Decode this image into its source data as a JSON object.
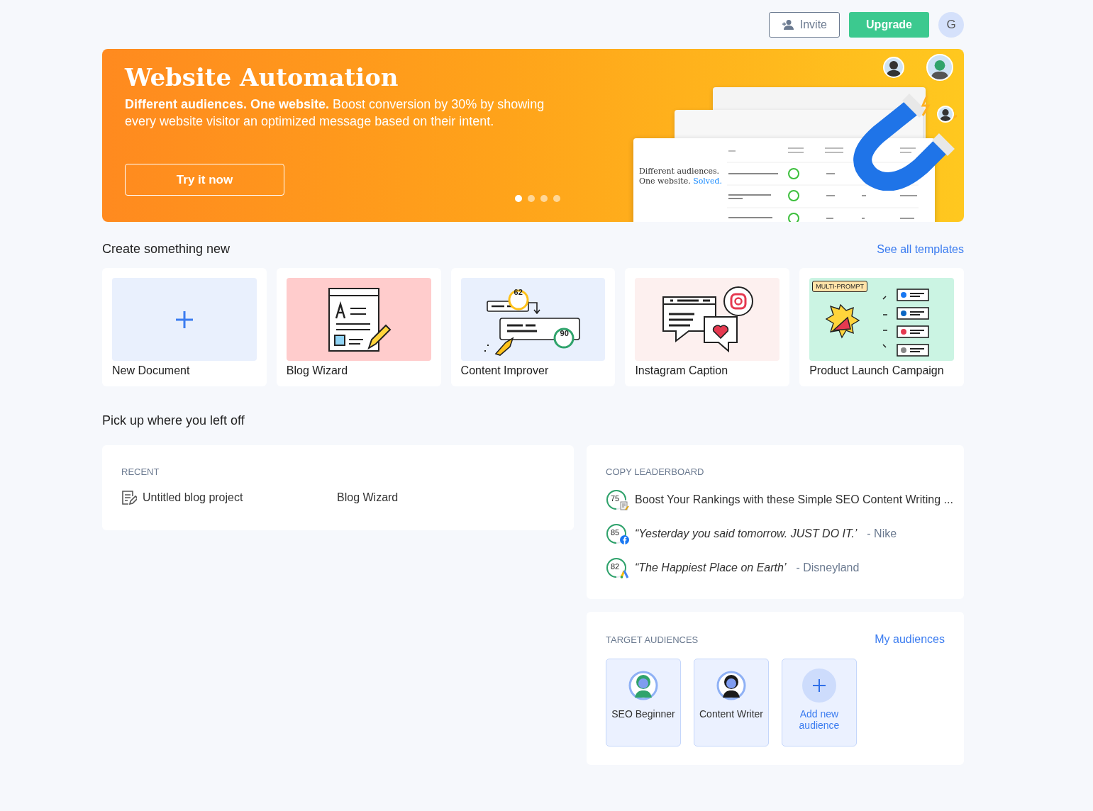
{
  "header": {
    "invite": "Invite",
    "upgrade": "Upgrade",
    "avatar": "G"
  },
  "banner": {
    "title": "Website Automation",
    "subtitle": "**Different audiences. One website.** Boost conversion by 30% by showing every website visitor an optimized message based on their intent.",
    "cta": "Try it now",
    "dots": [
      {
        "selected": true
      },
      {
        "selected": false
      },
      {
        "selected": false
      },
      {
        "selected": false
      }
    ],
    "mockup": {
      "headline": "Different audiences. One website.",
      "highlight": "Solved."
    }
  },
  "create": {
    "title": "Create something new",
    "link": "See all templates",
    "templates": [
      {
        "kind": "blank",
        "label": "New Document"
      },
      {
        "kind": "blog",
        "label": "Blog Wizard"
      },
      {
        "kind": "improver",
        "label": "Content Improver",
        "scores": [
          "62",
          "90"
        ]
      },
      {
        "kind": "instagram",
        "label": "Instagram Caption"
      },
      {
        "kind": "launch",
        "label": "Product Launch Campaign",
        "badge": "MULTI-PROMPT"
      }
    ]
  },
  "resume": {
    "title": "Pick up where you left off"
  },
  "recent": {
    "title": "RECENT",
    "items": [
      {
        "name": "Untitled blog project",
        "template": "Blog Wizard"
      }
    ]
  },
  "leaderboard": {
    "title": "COPY LEADERBOARD",
    "items": [
      {
        "kind": "article",
        "score": "75",
        "text": "Boost Your Rankings with these Simple SEO Content Writing ..."
      },
      {
        "kind": "quote",
        "score": "85",
        "text": "“Yesterday you said tomorrow. JUST DO IT.’",
        "author": "- Nike"
      },
      {
        "kind": "quote",
        "score": "82",
        "text": "“The Happiest Place on Earth’",
        "author": "- Disneyland"
      }
    ]
  },
  "audiences": {
    "title": "TARGET AUDIENCES",
    "link": "My audiences",
    "items": [
      {
        "kind": "persona",
        "name": "SEO Beginner",
        "color": "#2fa36b"
      },
      {
        "kind": "persona",
        "name": "Content Writer",
        "color": "#1a1a1a"
      },
      {
        "kind": "add",
        "name": "Add new audience"
      }
    ]
  }
}
